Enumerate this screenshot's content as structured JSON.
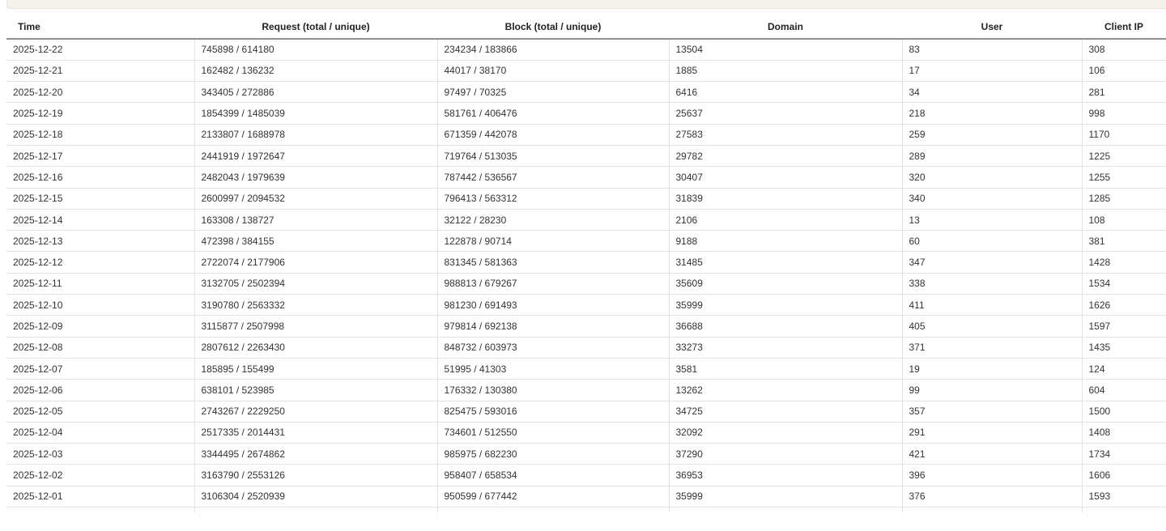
{
  "table": {
    "headers": [
      "Time",
      "Request (total / unique)",
      "Block (total / unique)",
      "Domain",
      "User",
      "Client IP"
    ],
    "rows": [
      [
        "2025-12-22",
        "745898 / 614180",
        "234234 / 183866",
        "13504",
        "83",
        "308"
      ],
      [
        "2025-12-21",
        "162482 / 136232",
        "44017 / 38170",
        "1885",
        "17",
        "106"
      ],
      [
        "2025-12-20",
        "343405 / 272886",
        "97497 / 70325",
        "6416",
        "34",
        "281"
      ],
      [
        "2025-12-19",
        "1854399 / 1485039",
        "581761 / 406476",
        "25637",
        "218",
        "998"
      ],
      [
        "2025-12-18",
        "2133807 / 1688978",
        "671359 / 442078",
        "27583",
        "259",
        "1170"
      ],
      [
        "2025-12-17",
        "2441919 / 1972647",
        "719764 / 513035",
        "29782",
        "289",
        "1225"
      ],
      [
        "2025-12-16",
        "2482043 / 1979639",
        "787442 / 536567",
        "30407",
        "320",
        "1255"
      ],
      [
        "2025-12-15",
        "2600997 / 2094532",
        "796413 / 563312",
        "31839",
        "340",
        "1285"
      ],
      [
        "2025-12-14",
        "163308 / 138727",
        "32122 / 28230",
        "2106",
        "13",
        "108"
      ],
      [
        "2025-12-13",
        "472398 / 384155",
        "122878 / 90714",
        "9188",
        "60",
        "381"
      ],
      [
        "2025-12-12",
        "2722074 / 2177906",
        "831345 / 581363",
        "31485",
        "347",
        "1428"
      ],
      [
        "2025-12-11",
        "3132705 / 2502394",
        "988813 / 679267",
        "35609",
        "338",
        "1534"
      ],
      [
        "2025-12-10",
        "3190780 / 2563332",
        "981230 / 691493",
        "35999",
        "411",
        "1626"
      ],
      [
        "2025-12-09",
        "3115877 / 2507998",
        "979814 / 692138",
        "36688",
        "405",
        "1597"
      ],
      [
        "2025-12-08",
        "2807612 / 2263430",
        "848732 / 603973",
        "33273",
        "371",
        "1435"
      ],
      [
        "2025-12-07",
        "185895 / 155499",
        "51995 / 41303",
        "3581",
        "19",
        "124"
      ],
      [
        "2025-12-06",
        "638101 / 523985",
        "176332 / 130380",
        "13262",
        "99",
        "604"
      ],
      [
        "2025-12-05",
        "2743267 / 2229250",
        "825475 / 593016",
        "34725",
        "357",
        "1500"
      ],
      [
        "2025-12-04",
        "2517335 / 2014431",
        "734601 / 512550",
        "32092",
        "291",
        "1408"
      ],
      [
        "2025-12-03",
        "3344495 / 2674862",
        "985975 / 682230",
        "37290",
        "421",
        "1734"
      ],
      [
        "2025-12-02",
        "3163790 / 2553126",
        "958407 / 658534",
        "36953",
        "396",
        "1606"
      ],
      [
        "2025-12-01",
        "3106304 / 2520939",
        "950599 / 677442",
        "35999",
        "376",
        "1593"
      ]
    ]
  }
}
